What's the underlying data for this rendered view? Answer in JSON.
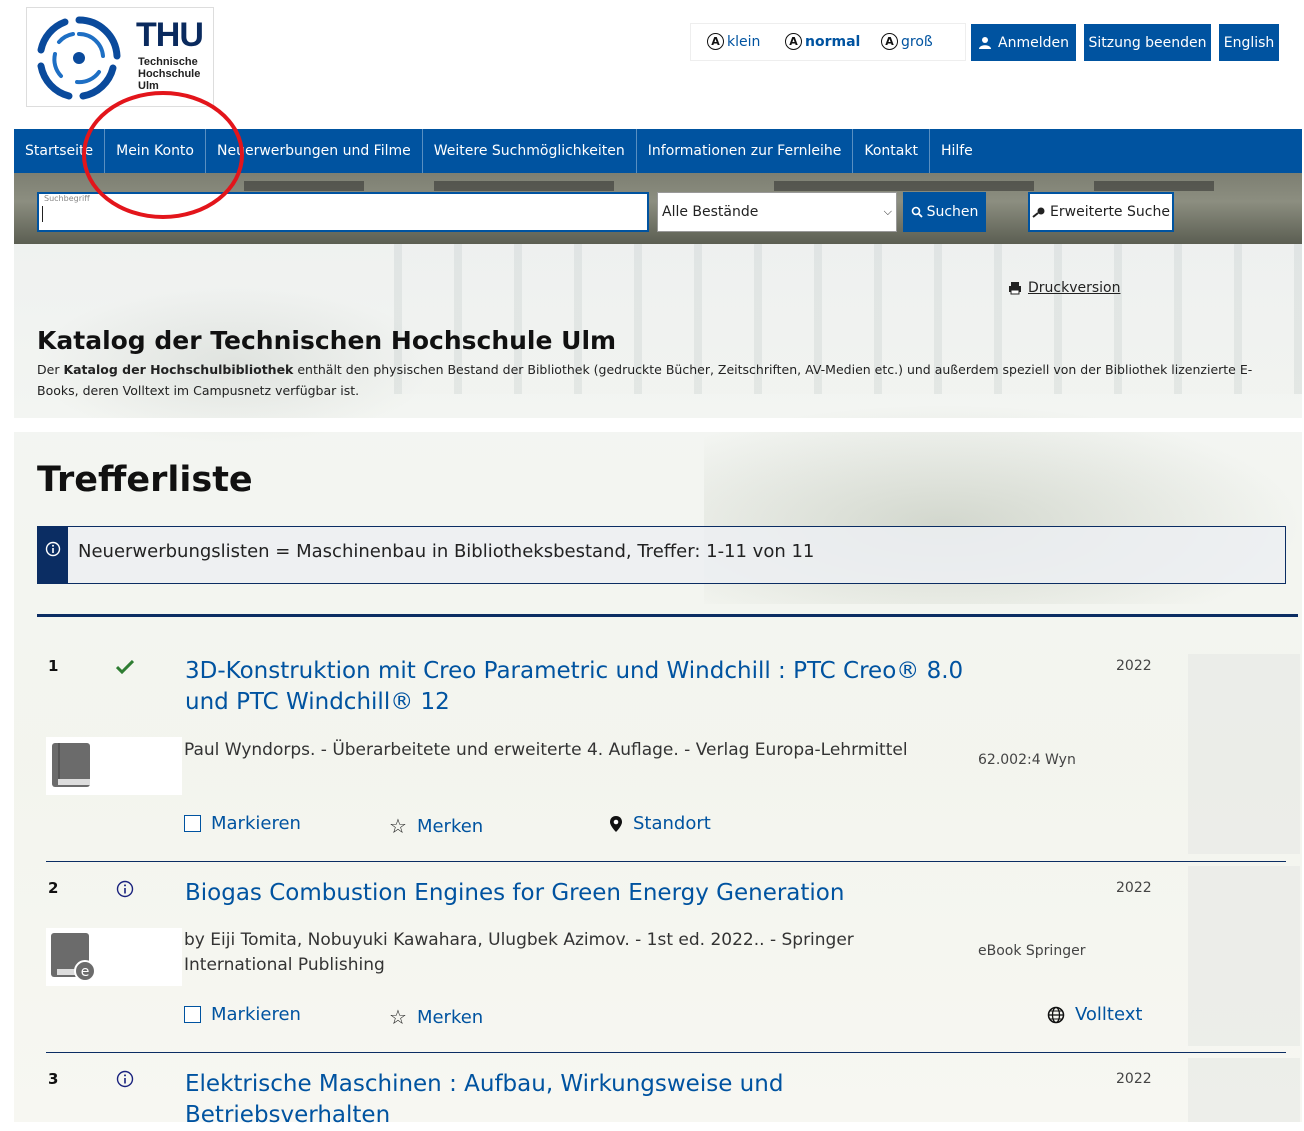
{
  "header": {
    "logo": {
      "brand": "THU",
      "subtitle_lines": [
        "Technische",
        "Hochschule",
        "Ulm"
      ]
    },
    "font_sizes": [
      {
        "glyph": "A",
        "label": "klein",
        "bold": false
      },
      {
        "glyph": "A",
        "label": "normal",
        "bold": true
      },
      {
        "glyph": "A",
        "label": "groß",
        "bold": false
      }
    ],
    "buttons": {
      "login": "Anmelden",
      "end_session": "Sitzung beenden",
      "language": "English"
    },
    "accent_color": "#0053a0"
  },
  "nav": {
    "items": [
      "Startseite",
      "Mein Konto",
      "Neuerwerbungen und Filme",
      "Weitere Suchmöglichkeiten",
      "Informationen zur Fernleihe",
      "Kontakt",
      "Hilfe"
    ]
  },
  "search": {
    "label": "Suchbegriff",
    "value": "",
    "scope_selected": "Alle Bestände",
    "search_button": "Suchen",
    "advanced_button": "Erweiterte Suche"
  },
  "intro": {
    "print_link": "Druckversion",
    "title": "Katalog der Technischen Hochschule Ulm",
    "desc_prefix": "Der ",
    "desc_bold": "Katalog der Hochschulbibliothek",
    "desc_suffix": " enthält den physischen Bestand der Bibliothek (gedruckte Bücher, Zeitschriften, AV-Medien etc.) und außerdem speziell von der Bibliothek lizenzierte E-Books, deren Volltext im Campusnetz verfügbar ist."
  },
  "results": {
    "heading": "Trefferliste",
    "info": "Neuerwerbungslisten = Maschinenbau in Bibliotheksbestand, Treffer: 1-11 von 11",
    "records": [
      {
        "num": "1",
        "status_icon": "checkmark-icon",
        "title": "3D-Konstruktion mit Creo Parametric und Windchill : PTC Creo® 8.0 und PTC Windchill® 12",
        "year": "2022",
        "media_icon": "book-icon",
        "meta": "Paul Wyndorps. - Überarbeitete und erweiterte 4. Auflage. - Verlag Europa-Lehrmittel",
        "signature": "62.002:4 Wyn",
        "actions": {
          "mark": "Markieren",
          "save": "Merken",
          "extra": "Standort"
        }
      },
      {
        "num": "2",
        "status_icon": "info-icon",
        "title": "Biogas Combustion Engines for Green Energy Generation",
        "year": "2022",
        "media_icon": "ebook-icon",
        "meta": "by Eiji Tomita, Nobuyuki Kawahara, Ulugbek Azimov. - 1st ed. 2022.. - Springer International Publishing",
        "signature": "eBook Springer",
        "actions": {
          "mark": "Markieren",
          "save": "Merken",
          "extra": "Volltext"
        }
      },
      {
        "num": "3",
        "status_icon": "info-icon",
        "title": "Elektrische Maschinen : Aufbau, Wirkungsweise und Betriebsverhalten",
        "year": "2022"
      }
    ]
  },
  "annotation": {
    "color": "#e3151b"
  }
}
